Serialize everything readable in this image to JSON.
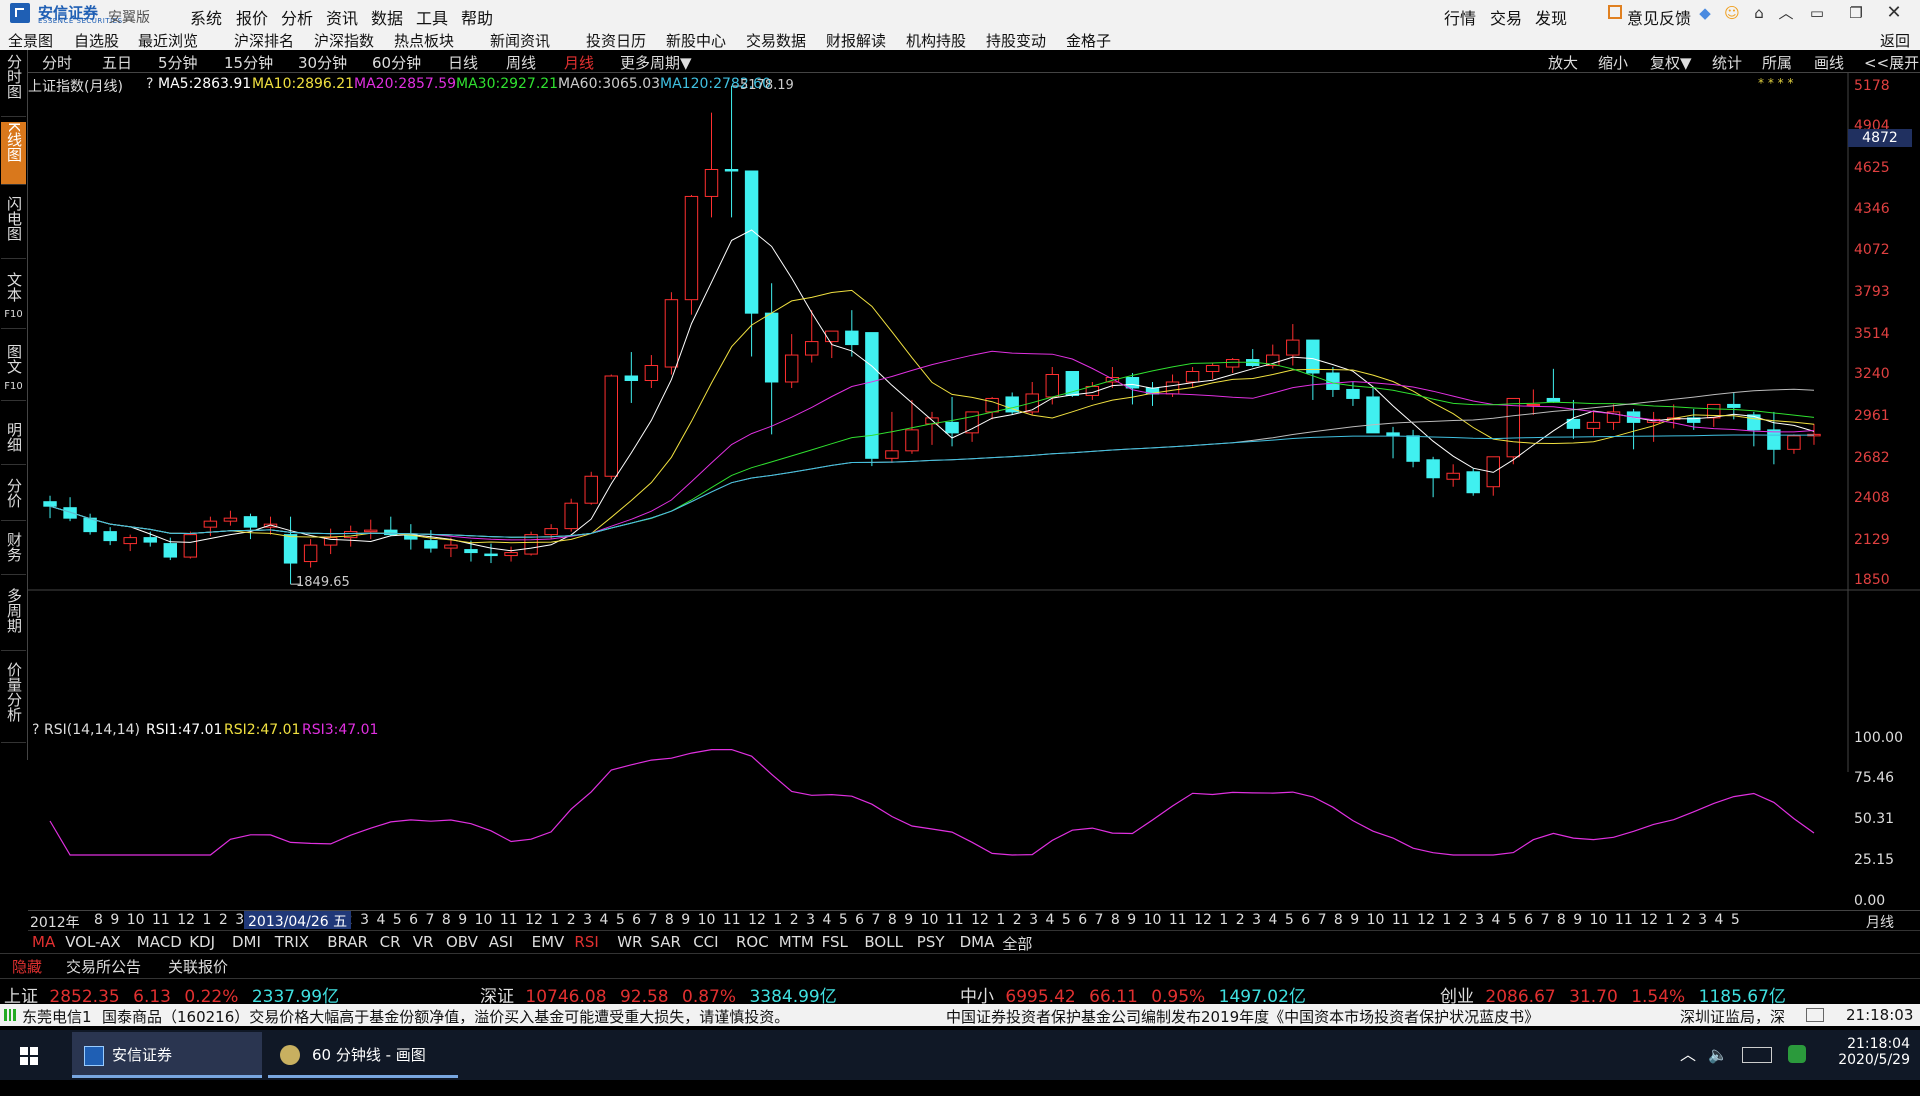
{
  "app": {
    "brand": "安信证券",
    "brand_sub": "ESSENCE SECURITIES",
    "edition": "安翼版",
    "menu": [
      "系统",
      "报价",
      "分析",
      "资讯",
      "数据",
      "工具",
      "帮助"
    ],
    "right_menu": [
      "行情",
      "交易",
      "发现"
    ],
    "feedback": "意见反馈"
  },
  "nav": {
    "items": [
      "全景图",
      "自选股",
      "最近浏览",
      "沪深排名",
      "沪深指数",
      "热点板块",
      "新闻资讯",
      "投资日历",
      "新股中心",
      "交易数据",
      "财报解读",
      "机构持股",
      "持股变动",
      "金格子"
    ],
    "back": "返回"
  },
  "sidebar": [
    {
      "label": "分时图"
    },
    {
      "label": "K线图",
      "active": true
    },
    {
      "label": "闪电图"
    },
    {
      "label": "文本",
      "sub": "F10"
    },
    {
      "label": "图文",
      "sub": "F10"
    },
    {
      "label": "明细"
    },
    {
      "label": "分价"
    },
    {
      "label": "财务"
    },
    {
      "label": "多周期"
    },
    {
      "label": "价量分析"
    }
  ],
  "periods": [
    "分时",
    "五日",
    "5分钟",
    "15分钟",
    "30分钟",
    "60分钟",
    "日线",
    "周线",
    "月线",
    "更多周期▼"
  ],
  "active_period": "月线",
  "tools": [
    "放大",
    "缩小",
    "复权▼",
    "统计",
    "所属",
    "画线",
    "<<展开"
  ],
  "main_legend": {
    "q": "?",
    "name": "上证指数(月线)",
    "ma5": "MA5:2863.91",
    "ma10": "MA10:2896.21",
    "ma20": "MA20:2857.59",
    "ma30": "MA30:2927.21",
    "ma60": "MA60:3065.03",
    "ma120": "MA120:2782.60"
  },
  "price_axis": [
    "5178",
    "4904",
    "4625",
    "4346",
    "4072",
    "3793",
    "3514",
    "3240",
    "2961",
    "2682",
    "2408",
    "2129",
    "1850"
  ],
  "current_price_tag": "4872",
  "annotations": {
    "high": "5178.19",
    "low": "1849.65"
  },
  "rsi_legend": {
    "q": "?",
    "name": "RSI(14,14,14)",
    "rsi1": "RSI1:47.01",
    "rsi2": "RSI2:47.01",
    "rsi3": "RSI3:47.01"
  },
  "rsi_axis": [
    "100.00",
    "75.46",
    "50.31",
    "25.15",
    "0.00"
  ],
  "time_axis": {
    "start": "2012年",
    "cursor": "2013/04/26 五",
    "labels": "8 9 10 11 12 1 2 3 10 11 12 1 2 3 4 5 6 7 8 9 10 11 12 1 2 3 4 5 6 7 8 9 10 11 12 1 2 3 4 5 6 7 8 9 10 11 12 1 2 3 4 5 6 7 8 9 10 11 12 1 2 3 4 5 6 7 8 9 10 11 12 1 2 3 4 5 6 7 8 9 10 11 12 1 2 3 4 5",
    "unit": "月线"
  },
  "indicator_tabs": [
    "MA",
    "VOL-AX",
    "MACD",
    "KDJ",
    "DMI",
    "TRIX",
    "BRAR",
    "CR",
    "VR",
    "OBV",
    "ASI",
    "EMV",
    "RSI",
    "WR",
    "SAR",
    "CCI",
    "ROC",
    "MTM",
    "FSL",
    "BOLL",
    "PSY",
    "DMA",
    "全部"
  ],
  "active_indicators": [
    "MA",
    "RSI"
  ],
  "lower_tabs": [
    "隐藏",
    "交易所公告",
    "关联报价"
  ],
  "indices": [
    {
      "name": "上证",
      "price": "2852.35",
      "chg": "6.13",
      "pct": "0.22%",
      "amt": "2337.99亿"
    },
    {
      "name": "深证",
      "price": "10746.08",
      "chg": "92.58",
      "pct": "0.87%",
      "amt": "3384.99亿"
    },
    {
      "name": "中小",
      "price": "6995.42",
      "chg": "66.11",
      "pct": "0.95%",
      "amt": "1497.02亿"
    },
    {
      "name": "创业",
      "price": "2086.67",
      "chg": "31.70",
      "pct": "1.54%",
      "amt": "1185.67亿"
    }
  ],
  "ticker": {
    "source": "东莞电信1",
    "msg1": "国泰商品（160216）交易价格大幅高于基金份额净值，溢价买入基金可能遭受重大损失，请谨慎投资。",
    "msg2": "中国证券投资者保护基金公司编制发布2019年度《中国资本市场投资者保护状况蓝皮书》",
    "msg3": "深圳证监局，深",
    "time": "21:18:03"
  },
  "taskbar": {
    "apps": [
      "安信证券",
      "60 分钟线 - 画图"
    ],
    "time": "21:18:04",
    "date": "2020/5/29"
  },
  "chart_data": {
    "type": "candlestick",
    "title": "上证指数(月线)",
    "ylim": [
      1850,
      5178
    ],
    "ohlc": [
      [
        2400,
        2440,
        2290,
        2370
      ],
      [
        2360,
        2430,
        2270,
        2290
      ],
      [
        2290,
        2320,
        2180,
        2200
      ],
      [
        2200,
        2230,
        2110,
        2140
      ],
      [
        2120,
        2180,
        2070,
        2160
      ],
      [
        2160,
        2200,
        2100,
        2130
      ],
      [
        2120,
        2160,
        2010,
        2030
      ],
      [
        2030,
        2200,
        2020,
        2180
      ],
      [
        2230,
        2300,
        2170,
        2270
      ],
      [
        2270,
        2340,
        2240,
        2290
      ],
      [
        2300,
        2320,
        2150,
        2230
      ],
      [
        2230,
        2300,
        2180,
        2250
      ],
      [
        2180,
        2300,
        1849,
        1990
      ],
      [
        2000,
        2150,
        1960,
        2110
      ],
      [
        2110,
        2220,
        2050,
        2160
      ],
      [
        2160,
        2240,
        2100,
        2200
      ],
      [
        2200,
        2280,
        2150,
        2210
      ],
      [
        2210,
        2300,
        2170,
        2180
      ],
      [
        2180,
        2250,
        2080,
        2150
      ],
      [
        2140,
        2210,
        2060,
        2090
      ],
      [
        2090,
        2160,
        2030,
        2110
      ],
      [
        2080,
        2140,
        2000,
        2060
      ],
      [
        2050,
        2120,
        1990,
        2040
      ],
      [
        2040,
        2100,
        2000,
        2060
      ],
      [
        2050,
        2200,
        2040,
        2180
      ],
      [
        2180,
        2250,
        2150,
        2220
      ],
      [
        2220,
        2420,
        2200,
        2390
      ],
      [
        2390,
        2600,
        2380,
        2570
      ],
      [
        2570,
        3250,
        2550,
        3240
      ],
      [
        3240,
        3400,
        3060,
        3210
      ],
      [
        3210,
        3380,
        3160,
        3310
      ],
      [
        3300,
        3800,
        3250,
        3750
      ],
      [
        3750,
        4450,
        3650,
        4440
      ],
      [
        4440,
        5000,
        4300,
        4620
      ],
      [
        4620,
        5178,
        4300,
        4610
      ],
      [
        4610,
        4300,
        3370,
        3660
      ],
      [
        3660,
        3860,
        2850,
        3200
      ],
      [
        3200,
        3520,
        3160,
        3380
      ],
      [
        3380,
        3680,
        3330,
        3470
      ],
      [
        3470,
        3530,
        3360,
        3540
      ],
      [
        3540,
        3680,
        3370,
        3450
      ],
      [
        3530,
        3300,
        2638,
        2690
      ],
      [
        2690,
        3000,
        2660,
        2740
      ],
      [
        2740,
        3080,
        2720,
        2880
      ],
      [
        2920,
        3000,
        2780,
        2960
      ],
      [
        2930,
        3100,
        2770,
        2860
      ],
      [
        2860,
        3000,
        2800,
        3000
      ],
      [
        3000,
        3100,
        2950,
        3090
      ],
      [
        3100,
        3130,
        2980,
        3000
      ],
      [
        3000,
        3200,
        2980,
        3120
      ],
      [
        3100,
        3300,
        3050,
        3250
      ],
      [
        3270,
        3220,
        3100,
        3110
      ],
      [
        3110,
        3200,
        3080,
        3170
      ],
      [
        3200,
        3300,
        3160,
        3230
      ],
      [
        3230,
        3260,
        3050,
        3160
      ],
      [
        3160,
        3200,
        3040,
        3120
      ],
      [
        3120,
        3250,
        3100,
        3200
      ],
      [
        3200,
        3300,
        3160,
        3270
      ],
      [
        3270,
        3330,
        3220,
        3310
      ],
      [
        3300,
        3360,
        3260,
        3350
      ],
      [
        3350,
        3420,
        3300,
        3310
      ],
      [
        3310,
        3450,
        3290,
        3380
      ],
      [
        3380,
        3587,
        3310,
        3480
      ],
      [
        3480,
        3420,
        3080,
        3260
      ],
      [
        3260,
        3300,
        3100,
        3150
      ],
      [
        3150,
        3200,
        3040,
        3090
      ],
      [
        3100,
        3170,
        2860,
        2860
      ],
      [
        2860,
        2900,
        2690,
        2840
      ],
      [
        2840,
        2880,
        2630,
        2670
      ],
      [
        2680,
        2700,
        2430,
        2560
      ],
      [
        2550,
        2650,
        2500,
        2590
      ],
      [
        2600,
        2620,
        2440,
        2460
      ],
      [
        2500,
        2700,
        2440,
        2700
      ],
      [
        2700,
        2950,
        2650,
        3090
      ],
      [
        3050,
        3150,
        2980,
        3050
      ],
      [
        3090,
        3288,
        3060,
        3070
      ],
      [
        2950,
        3080,
        2820,
        2890
      ],
      [
        2890,
        3000,
        2840,
        2930
      ],
      [
        2930,
        3050,
        2880,
        3000
      ],
      [
        3000,
        3020,
        2750,
        2930
      ],
      [
        2930,
        3000,
        2800,
        2950
      ],
      [
        2950,
        3050,
        2890,
        2960
      ],
      [
        2960,
        3020,
        2880,
        2930
      ],
      [
        2960,
        3040,
        2900,
        3050
      ],
      [
        3050,
        3130,
        2950,
        3030
      ],
      [
        2980,
        3000,
        2770,
        2880
      ],
      [
        2880,
        3000,
        2650,
        2750
      ],
      [
        2750,
        2850,
        2720,
        2840
      ],
      [
        2840,
        2920,
        2780,
        2850
      ]
    ]
  }
}
